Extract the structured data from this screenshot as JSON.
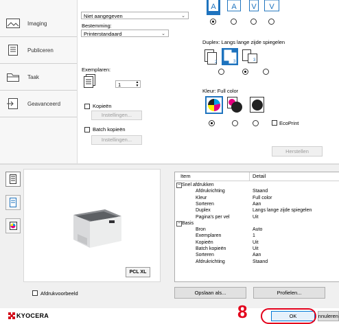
{
  "sidebar": {
    "items": [
      {
        "label": "Imaging",
        "icon": "imaging-icon"
      },
      {
        "label": "Publiceren",
        "icon": "publish-icon"
      },
      {
        "label": "Taak",
        "icon": "job-icon"
      },
      {
        "label": "Geavanceerd",
        "icon": "advanced-icon"
      }
    ]
  },
  "panel": {
    "top_select_value": "Niet aangegeven",
    "destination_label": "Bestemming:",
    "destination_value": "Printerstandaard",
    "copies_label": "Exemplaren:",
    "copies_value": "1",
    "collate_label": "Kopieën",
    "collate_settings_button": "Instellingen...",
    "batch_label": "Batch kopieën",
    "batch_settings_button": "Instellingen...",
    "duplex_label": "Duplex:",
    "duplex_value": "Langs lange zijde spiegelen",
    "color_label": "Kleur:",
    "color_value": "Full color",
    "ecoprint_label": "EcoPrint",
    "reset_button": "Herstellen"
  },
  "preview": {
    "badge": "PCL XL",
    "checkbox_label": "Afdrukvoorbeeld"
  },
  "detail": {
    "headers": [
      "Item",
      "Detail"
    ],
    "rows": [
      {
        "kind": "group",
        "item": "Snel afdrukken",
        "detail": ""
      },
      {
        "kind": "row",
        "item": "Afdrukrichting",
        "detail": "Staand"
      },
      {
        "kind": "row",
        "item": "Kleur",
        "detail": "Full color"
      },
      {
        "kind": "row",
        "item": "Sorteren",
        "detail": "Aan"
      },
      {
        "kind": "row",
        "item": "Duplex",
        "detail": "Langs lange zijde spiegelen"
      },
      {
        "kind": "row",
        "item": "Pagina's per vel",
        "detail": "Uit"
      },
      {
        "kind": "group",
        "item": "Basis",
        "detail": ""
      },
      {
        "kind": "row",
        "item": "Bron",
        "detail": "Auto"
      },
      {
        "kind": "row",
        "item": "Exemplaren",
        "detail": "1"
      },
      {
        "kind": "row",
        "item": "Kopieën",
        "detail": "Uit"
      },
      {
        "kind": "row",
        "item": "Batch kopieën",
        "detail": "Uit"
      },
      {
        "kind": "row",
        "item": "Sorteren",
        "detail": "Aan"
      },
      {
        "kind": "row",
        "item": "Afdrukrichting",
        "detail": "Staand"
      }
    ]
  },
  "actions": {
    "save_as": "Opslaan als...",
    "profiles": "Profielen..."
  },
  "footer": {
    "brand": "KYOCERA",
    "step_number": "8",
    "ok_button": "OK",
    "cancel_button": "Annuleren"
  },
  "colors": {
    "accent_blue": "#1e73be",
    "highlight_red": "#e3001b",
    "brand_red": "#d40f1c"
  }
}
